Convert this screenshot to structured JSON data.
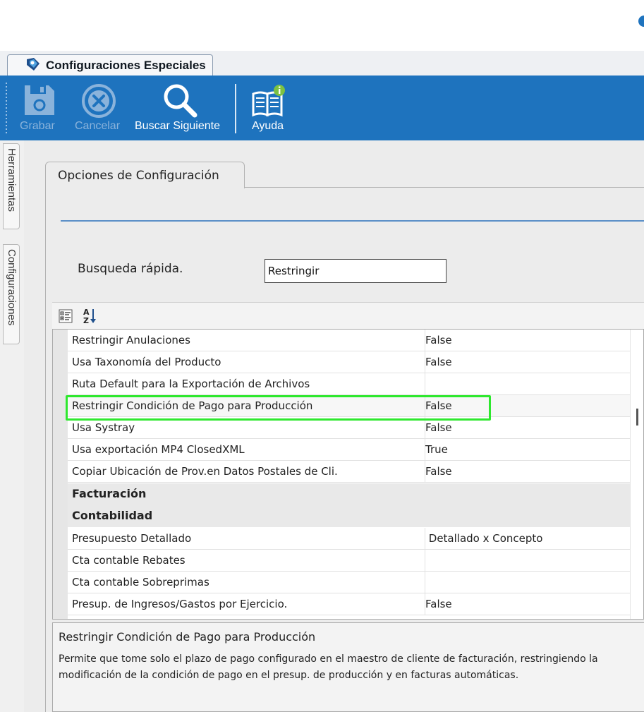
{
  "window": {
    "tab_title": "Configuraciones Especiales"
  },
  "toolbar": {
    "save_label": "Grabar",
    "cancel_label": "Cancelar",
    "find_next_label": "Buscar Siguiente",
    "help_label": "Ayuda"
  },
  "side_tabs": {
    "tools": "Herramientas",
    "configs": "Configuraciones"
  },
  "panel": {
    "tab_label": "Opciones de Configuración",
    "search_label": "Busqueda rápida.",
    "search_value": "Restringir"
  },
  "grid": {
    "rows": [
      {
        "name": "Restringir Anulaciones",
        "value": "False"
      },
      {
        "name": "Usa Taxonomía del Producto",
        "value": "False"
      },
      {
        "name": "Ruta Default para la Exportación de Archivos",
        "value": ""
      },
      {
        "name": "Restringir Condición de Pago para Producción",
        "value": "False"
      },
      {
        "name": "Usa Systray",
        "value": "False"
      },
      {
        "name": "Usa exportación MP4 ClosedXML",
        "value": "True"
      },
      {
        "name": "Copiar Ubicación de Prov.en Datos Postales de Cli.",
        "value": "False"
      }
    ],
    "categories": [
      "Facturación",
      "Contabilidad"
    ],
    "rows2": [
      {
        "name": "Presupuesto Detallado",
        "value": " Detallado x Concepto"
      },
      {
        "name": "Cta contable Rebates",
        "value": ""
      },
      {
        "name": "Cta contable Sobreprimas",
        "value": ""
      },
      {
        "name": "Presup. de Ingresos/Gastos por Ejercicio.",
        "value": "False"
      }
    ]
  },
  "help": {
    "title": "Restringir Condición de Pago para Producción",
    "description": "Permite que tome solo el plazo de pago configurado en el maestro de cliente de facturación, restringiendo la modificación de la condición de pago en el presup. de producción y en facturas automáticas."
  },
  "colors": {
    "toolbar_blue": "#1e73be",
    "highlight_green": "#2ee82e"
  }
}
